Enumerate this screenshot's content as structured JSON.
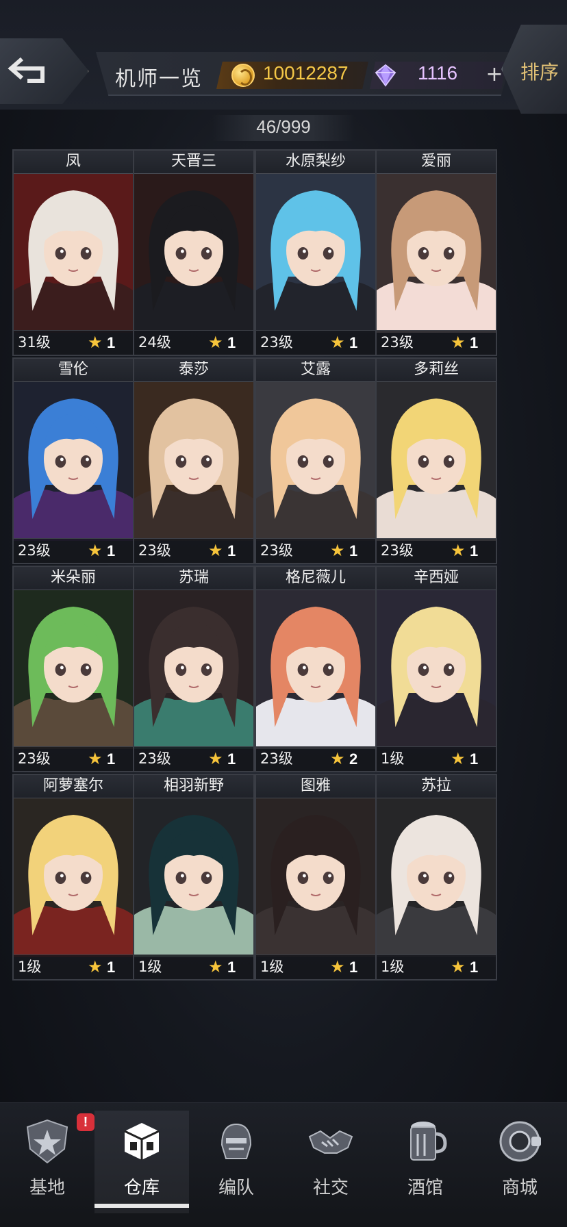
{
  "header": {
    "title": "机师一览",
    "gold": "10012287",
    "gems": "1116",
    "plus_label": "+",
    "sort_label": "排序"
  },
  "roster_count": "46/999",
  "pilots": [
    {
      "name": "凤",
      "level": "31级",
      "rank": "1",
      "hair": "#e9e3dc",
      "outfit": "#3b1d1d",
      "bg": "#5a1a1a"
    },
    {
      "name": "天晋三",
      "level": "24级",
      "rank": "1",
      "hair": "#1b1b1f",
      "outfit": "#1d1e24",
      "bg": "#2a1a1a"
    },
    {
      "name": "水原梨纱",
      "level": "23级",
      "rank": "1",
      "hair": "#5fc2e8",
      "outfit": "#22242c",
      "bg": "#2c3444"
    },
    {
      "name": "爱丽",
      "level": "23级",
      "rank": "1",
      "hair": "#c79a78",
      "outfit": "#f3dcd6",
      "bg": "#3a3030"
    },
    {
      "name": "雪伦",
      "level": "23级",
      "rank": "1",
      "hair": "#3b7fd6",
      "outfit": "#4a2a6a",
      "bg": "#1e2230"
    },
    {
      "name": "泰莎",
      "level": "23级",
      "rank": "1",
      "hair": "#e2c2a0",
      "outfit": "#3a2e2a",
      "bg": "#3a2a20"
    },
    {
      "name": "艾露",
      "level": "23级",
      "rank": "1",
      "hair": "#f0c79a",
      "outfit": "#3a3434",
      "bg": "#3a3a40"
    },
    {
      "name": "多莉丝",
      "level": "23级",
      "rank": "1",
      "hair": "#f2d576",
      "outfit": "#e9dcd4",
      "bg": "#2a2a2e"
    },
    {
      "name": "米朵丽",
      "level": "23级",
      "rank": "1",
      "hair": "#6dbb5a",
      "outfit": "#5a4a3a",
      "bg": "#1e2a1e"
    },
    {
      "name": "苏瑞",
      "level": "23级",
      "rank": "1",
      "hair": "#3a2e2e",
      "outfit": "#3a7c6e",
      "bg": "#2a2224"
    },
    {
      "name": "格尼薇儿",
      "level": "23级",
      "rank": "2",
      "hair": "#e48664",
      "outfit": "#e6e6ec",
      "bg": "#2c2a34"
    },
    {
      "name": "辛西娅",
      "level": "1级",
      "rank": "1",
      "hair": "#f1dc96",
      "outfit": "#2a2630",
      "bg": "#2a2836"
    },
    {
      "name": "阿萝塞尔",
      "level": "1级",
      "rank": "1",
      "hair": "#f2d27a",
      "outfit": "#7a2420",
      "bg": "#2a2622"
    },
    {
      "name": "相羽新野",
      "level": "1级",
      "rank": "1",
      "hair": "#173238",
      "outfit": "#9ab8a6",
      "bg": "#222428"
    },
    {
      "name": "图雅",
      "level": "1级",
      "rank": "1",
      "hair": "#2a2020",
      "outfit": "#3a3232",
      "bg": "#2a2424"
    },
    {
      "name": "苏拉",
      "level": "1级",
      "rank": "1",
      "hair": "#ece4de",
      "outfit": "#3a3a3e",
      "bg": "#262628"
    }
  ],
  "nav": [
    {
      "label": "基地",
      "icon": "base-icon"
    },
    {
      "label": "仓库",
      "icon": "warehouse-icon"
    },
    {
      "label": "编队",
      "icon": "squad-icon"
    },
    {
      "label": "社交",
      "icon": "social-icon"
    },
    {
      "label": "酒馆",
      "icon": "tavern-icon"
    },
    {
      "label": "商城",
      "icon": "shop-icon"
    }
  ],
  "nav_alert": "!",
  "active_tab": "仓库"
}
